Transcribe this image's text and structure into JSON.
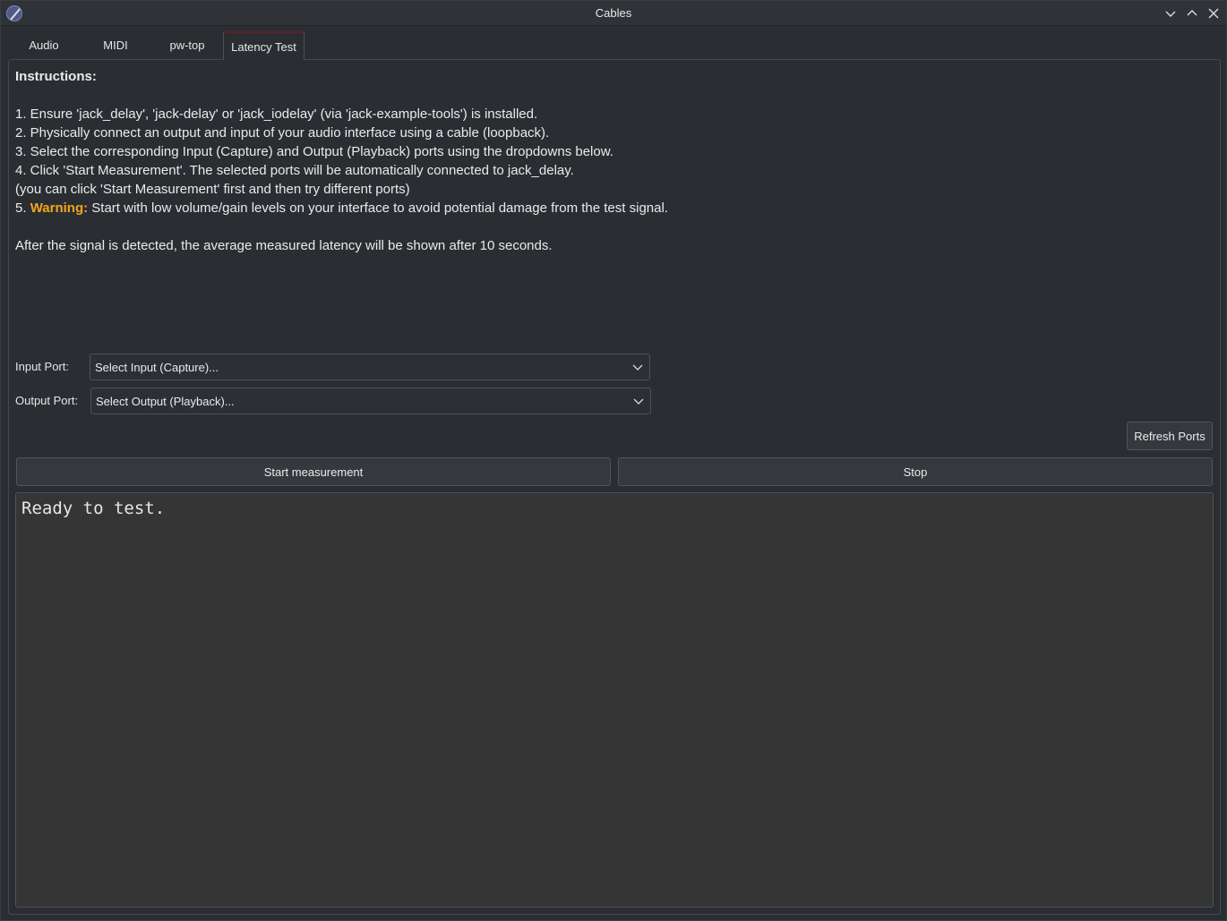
{
  "window": {
    "title": "Cables"
  },
  "titlebar_buttons": {
    "minimize": "chevron-down-icon",
    "maximize": "chevron-up-icon",
    "close": "close-icon"
  },
  "tabs": [
    {
      "label": "Audio"
    },
    {
      "label": "MIDI"
    },
    {
      "label": "pw-top"
    },
    {
      "label": "Latency Test",
      "active": true
    }
  ],
  "instructions": {
    "heading": "Instructions:",
    "step1": "1. Ensure 'jack_delay', 'jack-delay' or 'jack_iodelay' (via 'jack-example-tools') is installed.",
    "step2": "2. Physically connect an output and input of your audio interface using a cable (loopback).",
    "step3": "3. Select the corresponding Input (Capture) and Output (Playback) ports using the dropdowns below.",
    "step4": "4. Click 'Start Measurement'. The selected ports will be automatically connected to jack_delay.",
    "step4_note": "(you can click 'Start Measurement' first and then try different ports)",
    "step5_prefix": "5. ",
    "step5_warning": "Warning:",
    "step5_text": " Start with low volume/gain levels on your interface to avoid potential damage from the test signal.",
    "footer": "After the signal is detected, the average measured latency will be shown after 10 seconds."
  },
  "ports": {
    "input_label": "Input  Port:",
    "input_value": "Select Input (Capture)...",
    "output_label": "Output Port:",
    "output_value": "Select Output (Playback)..."
  },
  "buttons": {
    "refresh": "Refresh Ports",
    "start": "Start measurement",
    "stop": "Stop"
  },
  "output_text": "Ready to test.",
  "colors": {
    "warning": "#f4a51c",
    "background": "#2a2e32"
  }
}
